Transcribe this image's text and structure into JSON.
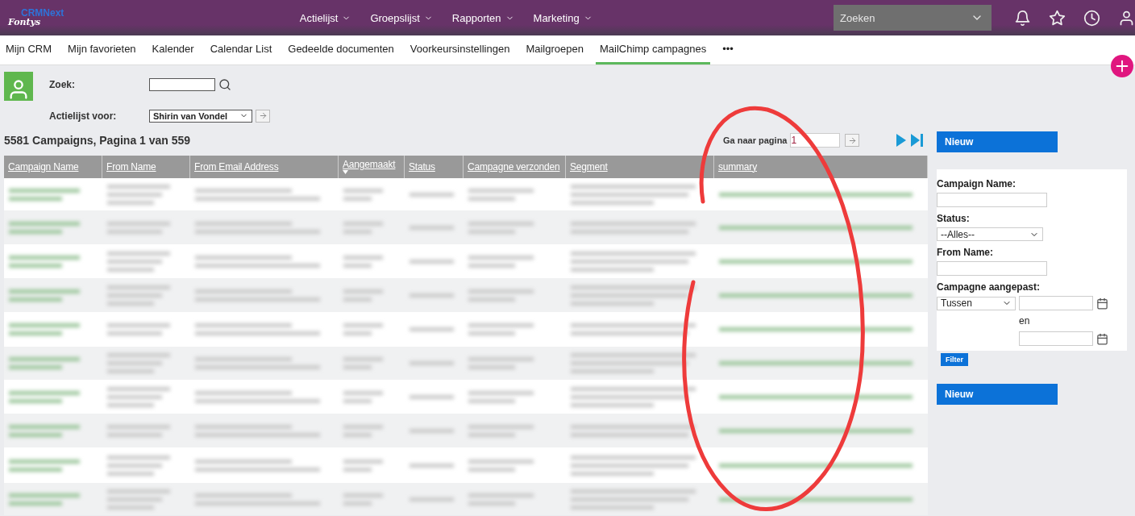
{
  "header": {
    "logo": {
      "top": "CRMNext",
      "bottom": "Fontys"
    },
    "menu": [
      {
        "label": "Actielijst"
      },
      {
        "label": "Groepslijst"
      },
      {
        "label": "Rapporten"
      },
      {
        "label": "Marketing"
      }
    ],
    "search": {
      "placeholder": "Zoeken"
    }
  },
  "tabs": [
    {
      "label": "Mijn CRM",
      "selected": false
    },
    {
      "label": "Mijn favorieten",
      "selected": false
    },
    {
      "label": "Kalender",
      "selected": false
    },
    {
      "label": "Calendar List",
      "selected": false
    },
    {
      "label": "Gedeelde documenten",
      "selected": false
    },
    {
      "label": "Voorkeursinstellingen",
      "selected": false
    },
    {
      "label": "Mailgroepen",
      "selected": false
    },
    {
      "label": "MailChimp campagnes",
      "selected": true
    },
    {
      "label": "•••",
      "selected": false
    }
  ],
  "filter_top": {
    "search_label": "Zoek:",
    "list_label": "Actielijst voor:",
    "list_value": "Shirin van Vondel"
  },
  "list": {
    "summary": "5581 Campaigns, Pagina 1 van 559",
    "goto_label": "Ga naar pagina",
    "goto_value": "1",
    "columns": [
      {
        "label": "Campaign Name",
        "sorted": false
      },
      {
        "label": "From Name",
        "sorted": false
      },
      {
        "label": "From Email Address",
        "sorted": false
      },
      {
        "label": "Aangemaakt",
        "sorted": true
      },
      {
        "label": "Status",
        "sorted": false
      },
      {
        "label": "Campagne verzonden",
        "sorted": false
      },
      {
        "label": "Segment",
        "sorted": false
      },
      {
        "label": "summary",
        "sorted": false
      }
    ]
  },
  "sidebar": {
    "new_top": "Nieuw",
    "fields": [
      {
        "kind": "text",
        "label": "Campaign Name:"
      },
      {
        "kind": "select",
        "label": "Status:",
        "value": "--Alles--"
      },
      {
        "kind": "text",
        "label": "From Name:"
      },
      {
        "kind": "range",
        "label": "Campagne aangepast:",
        "value": "Tussen",
        "between": "en"
      }
    ],
    "filter": "Filter",
    "new_bottom": "Nieuw"
  }
}
